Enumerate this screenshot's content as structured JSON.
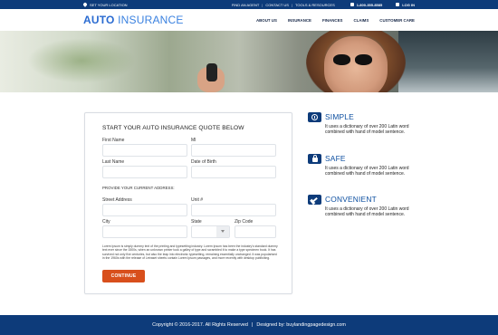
{
  "topbar": {
    "location": "SET YOUR LOCATION",
    "find_agent": "FIND AN AGENT",
    "sep1": "|",
    "contact": "CONTACT US",
    "sep2": "|",
    "tools": "TOOLS & RESOURCES",
    "phone": "1-800-355-8585",
    "login": "LOG IN"
  },
  "header": {
    "logo_bold": "AUTO",
    "logo_light": "INSURANCE",
    "nav": [
      "ABOUT US",
      "INSURANCE",
      "FINANCES",
      "CLAIMS",
      "CUSTOMER CARE"
    ]
  },
  "form": {
    "title": "START YOUR AUTO INSURANCE QUOTE BELOW",
    "first_name": "First Name",
    "mi": "MI",
    "last_name": "Last Name",
    "dob": "Date of Birth",
    "address_section": "PROVIDE YOUR CURRENT ADDRESS:",
    "street": "Street Address",
    "unit": "Unit #",
    "city": "City",
    "state": "State",
    "zip": "Zip Code",
    "disclaimer": "Lorem Ipsum is simply dummy text of the printing and typesetting industry. Lorem Ipsum has been the industry's standard dummy text ever since the 1500s, when an unknown printer took a galley of type and scrambled it to make a type specimen book. It has survived not only five centuries, but also the leap into electronic typesetting, remaining essentially unchanged. It was popularised in the 1960s with the release of Letraset sheets contain Lorem Ipsum passages, and more recently with desktop publishing.",
    "continue": "CONTINUE"
  },
  "features": [
    {
      "title": "SIMPLE",
      "desc": "It uses a dictionary of over 200 Latin word combined with hand of model sentence.",
      "icon": "clock-icon"
    },
    {
      "title": "SAFE",
      "desc": "It uses a dictionary of over 200 Latin word combined with hand of model sentence.",
      "icon": "lock-icon"
    },
    {
      "title": "CONVENIENT",
      "desc": "It uses a dictionary of over 200 Latin word combined with hand of model sentence.",
      "icon": "hammer-icon"
    }
  ],
  "footer": {
    "copyright": "Copyright © 2016-2017. All Rights Reserved",
    "sep": "|",
    "designed": "Designed by: buylandingpagedesign.com"
  },
  "colors": {
    "navy": "#0d3b7a",
    "accent": "#d84f1c",
    "logo": "#2a6bd1"
  }
}
